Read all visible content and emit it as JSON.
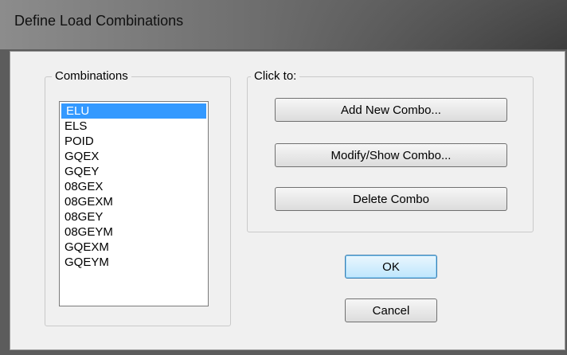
{
  "window": {
    "title": "Define Load Combinations"
  },
  "combinations": {
    "caption": "Combinations",
    "items": [
      "ELU",
      "ELS",
      "POID",
      "GQEX",
      "GQEY",
      "08GEX",
      "08GEXM",
      "08GEY",
      "08GEYM",
      "GQEXM",
      "GQEYM"
    ],
    "selected": "ELU"
  },
  "actions": {
    "caption": "Click to:",
    "add_label": "Add New Combo...",
    "modify_label": "Modify/Show Combo...",
    "delete_label": "Delete Combo"
  },
  "buttons": {
    "ok_label": "OK",
    "cancel_label": "Cancel"
  },
  "colors": {
    "selection": "#3399ff",
    "dialog_face": "#f0f0f0",
    "default_button_border": "#3c7fb1"
  }
}
